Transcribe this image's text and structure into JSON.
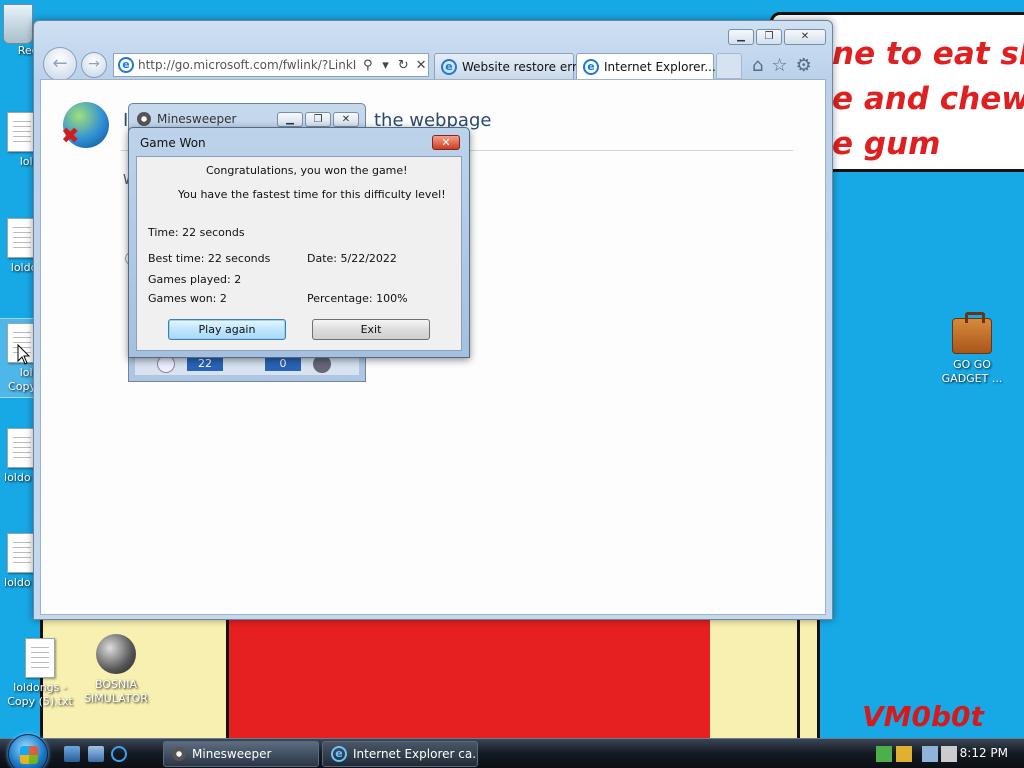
{
  "wallpaper": {
    "speech_lines": [
      "ne to eat shit",
      "e and chew",
      "e gum"
    ],
    "signature": "VM0b0t"
  },
  "desktop_icons": [
    {
      "label": "Recy"
    },
    {
      "label": "loldo"
    },
    {
      "label": "loldo Co"
    },
    {
      "label": "loldo Copy"
    },
    {
      "label": "loldo Copy"
    },
    {
      "label": "loldo Copy"
    },
    {
      "label": "loldongs - Copy (5).txt"
    },
    {
      "label": "BOSNIA SIMULATOR"
    },
    {
      "label": "GO GO GADGET ..."
    }
  ],
  "ie": {
    "address": "http://go.microsoft.com/fwlink/?LinkID=",
    "address_domain": "microsoft.com",
    "tabs": [
      {
        "label": "Website restore error"
      },
      {
        "label": "Internet Explorer..."
      }
    ],
    "error_title_start": "I",
    "error_title_end": "the webpage",
    "error_body": "W"
  },
  "minesweeper": {
    "title": "Minesweeper",
    "time": "22",
    "mines": "0"
  },
  "dialog": {
    "title": "Game Won",
    "congrats": "Congratulations, you won the game!",
    "fastest": "You have the fastest time for this difficulty level!",
    "time": "Time: 22 seconds",
    "best_time": "Best time: 22 seconds",
    "date": "Date: 5/22/2022",
    "games_played": "Games played: 2",
    "games_won": "Games won: 2",
    "percentage": "Percentage: 100%",
    "play_again": "Play again",
    "exit": "Exit"
  },
  "taskbar": {
    "buttons": [
      {
        "label": "Minesweeper"
      },
      {
        "label": "Internet Explorer ca..."
      }
    ],
    "clock": "8:12 PM"
  },
  "colors": {
    "desktop": "#17a9e6",
    "speech_text": "#e02020",
    "creature_red": "#e62020",
    "creature_yellow": "#f7f0b0"
  }
}
